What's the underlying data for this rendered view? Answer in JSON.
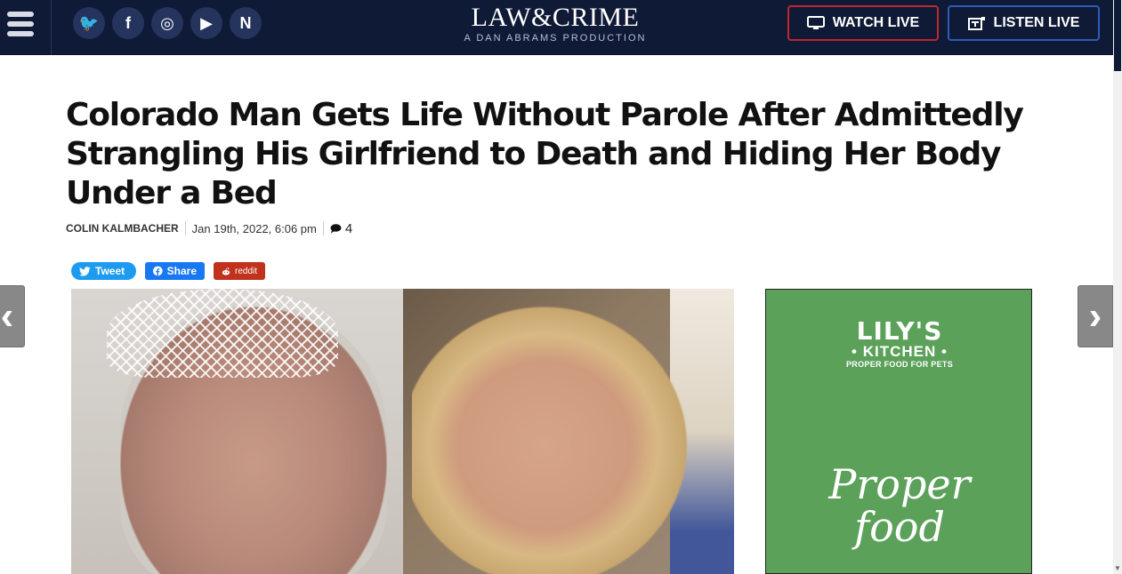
{
  "header": {
    "menu_icon": "hamburger-icon",
    "social": [
      {
        "name": "twitter",
        "glyph": "🐦",
        "icon": "twitter-icon"
      },
      {
        "name": "facebook",
        "glyph": "f",
        "icon": "facebook-icon"
      },
      {
        "name": "instagram",
        "glyph": "◎",
        "icon": "instagram-icon"
      },
      {
        "name": "youtube",
        "glyph": "▶",
        "icon": "youtube-icon"
      },
      {
        "name": "newsbreak",
        "glyph": "N",
        "icon": "newsbreak-icon"
      }
    ],
    "logo_main": "LAW&CRIME",
    "logo_sub": "A DAN ABRAMS PRODUCTION",
    "watch_live": "WATCH LIVE",
    "listen_live": "LISTEN LIVE",
    "watch_color": "#c0272d",
    "listen_color": "#2e5cb8",
    "bg_color": "#0f1a36"
  },
  "article": {
    "headline": "Colorado Man Gets Life Without Parole After Admittedly Strangling His Girlfriend to Death and Hiding Her Body Under a Bed",
    "author": "COLIN KALMBACHER",
    "date": "Jan 19th, 2022, 6:06 pm",
    "comment_count": "4"
  },
  "share": {
    "tweet": "Tweet",
    "share": "Share",
    "reddit": "reddit"
  },
  "ad": {
    "brand": "LILY'S",
    "kitchen": "• KITCHEN •",
    "tagline": "PROPER FOOD FOR PETS",
    "copy_line1": "Proper",
    "copy_line2": "food",
    "bg_color": "#5ba15a"
  },
  "nav": {
    "prev": "‹",
    "next": "›"
  }
}
